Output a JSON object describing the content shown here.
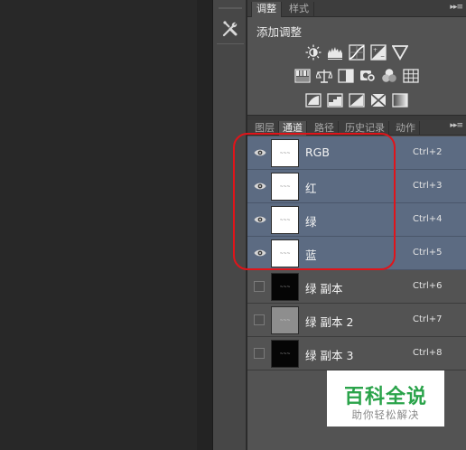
{
  "adjustments_panel": {
    "tabs": [
      "调整",
      "样式"
    ],
    "title": "添加调整",
    "icon_rows": [
      [
        "brightness-contrast-icon",
        "levels-icon",
        "curves-icon",
        "exposure-icon",
        "vibrance-icon"
      ],
      [
        "hue-saturation-icon",
        "color-balance-icon",
        "black-white-icon",
        "photo-filter-icon",
        "channel-mixer-icon",
        "color-lookup-icon"
      ],
      [
        "invert-icon",
        "posterize-icon",
        "threshold-icon",
        "selective-color-icon",
        "gradient-map-icon"
      ]
    ]
  },
  "channels_panel": {
    "tabs": [
      "图层",
      "通道",
      "路径",
      "历史记录",
      "动作"
    ],
    "active_tab": "通道",
    "channels": [
      {
        "name": "RGB",
        "shortcut": "Ctrl+2",
        "visible": true,
        "selected": true,
        "thumb": "white"
      },
      {
        "name": "红",
        "shortcut": "Ctrl+3",
        "visible": true,
        "selected": true,
        "thumb": "white"
      },
      {
        "name": "绿",
        "shortcut": "Ctrl+4",
        "visible": true,
        "selected": true,
        "thumb": "white"
      },
      {
        "name": "蓝",
        "shortcut": "Ctrl+5",
        "visible": true,
        "selected": true,
        "thumb": "white"
      },
      {
        "name": "绿 副本",
        "shortcut": "Ctrl+6",
        "visible": false,
        "selected": false,
        "thumb": "black"
      },
      {
        "name": "绿 副本 2",
        "shortcut": "Ctrl+7",
        "visible": false,
        "selected": false,
        "thumb": "gray"
      },
      {
        "name": "绿 副本 3",
        "shortcut": "Ctrl+8",
        "visible": false,
        "selected": false,
        "thumb": "black"
      }
    ]
  },
  "watermark": {
    "title": "百科全说",
    "subtitle": "助你轻松解决"
  },
  "colors": {
    "selection": "#5c6b82",
    "highlight_ring": "#e0141a",
    "watermark_green": "#2aa34a"
  }
}
